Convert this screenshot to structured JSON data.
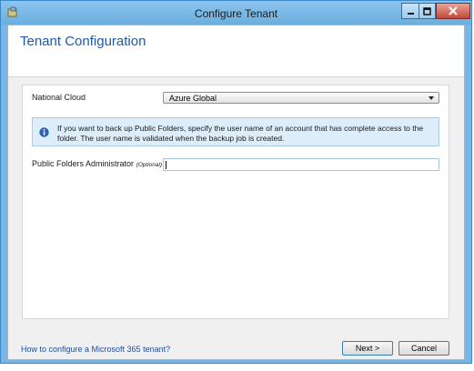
{
  "window": {
    "title": "Configure Tenant"
  },
  "header": {
    "title": "Tenant Configuration"
  },
  "form": {
    "national_cloud_label": "National Cloud",
    "national_cloud_value": "Azure Global",
    "info_message": "If you want to back up Public Folders, specify the user name of an account that has complete access to the folder. The user name is validated when the backup job is created.",
    "public_folders_label": "Public Folders Administrator",
    "public_folders_optional": "(Optional)",
    "public_folders_value": ""
  },
  "footer": {
    "help_link": "How to configure a Microsoft 365 tenant?",
    "next_label": "Next >",
    "cancel_label": "Cancel"
  },
  "colors": {
    "titlebar": "#78b6e6",
    "accent_text": "#1f5aa6",
    "info_background": "#ddeefa",
    "close_button": "#c4473a"
  }
}
